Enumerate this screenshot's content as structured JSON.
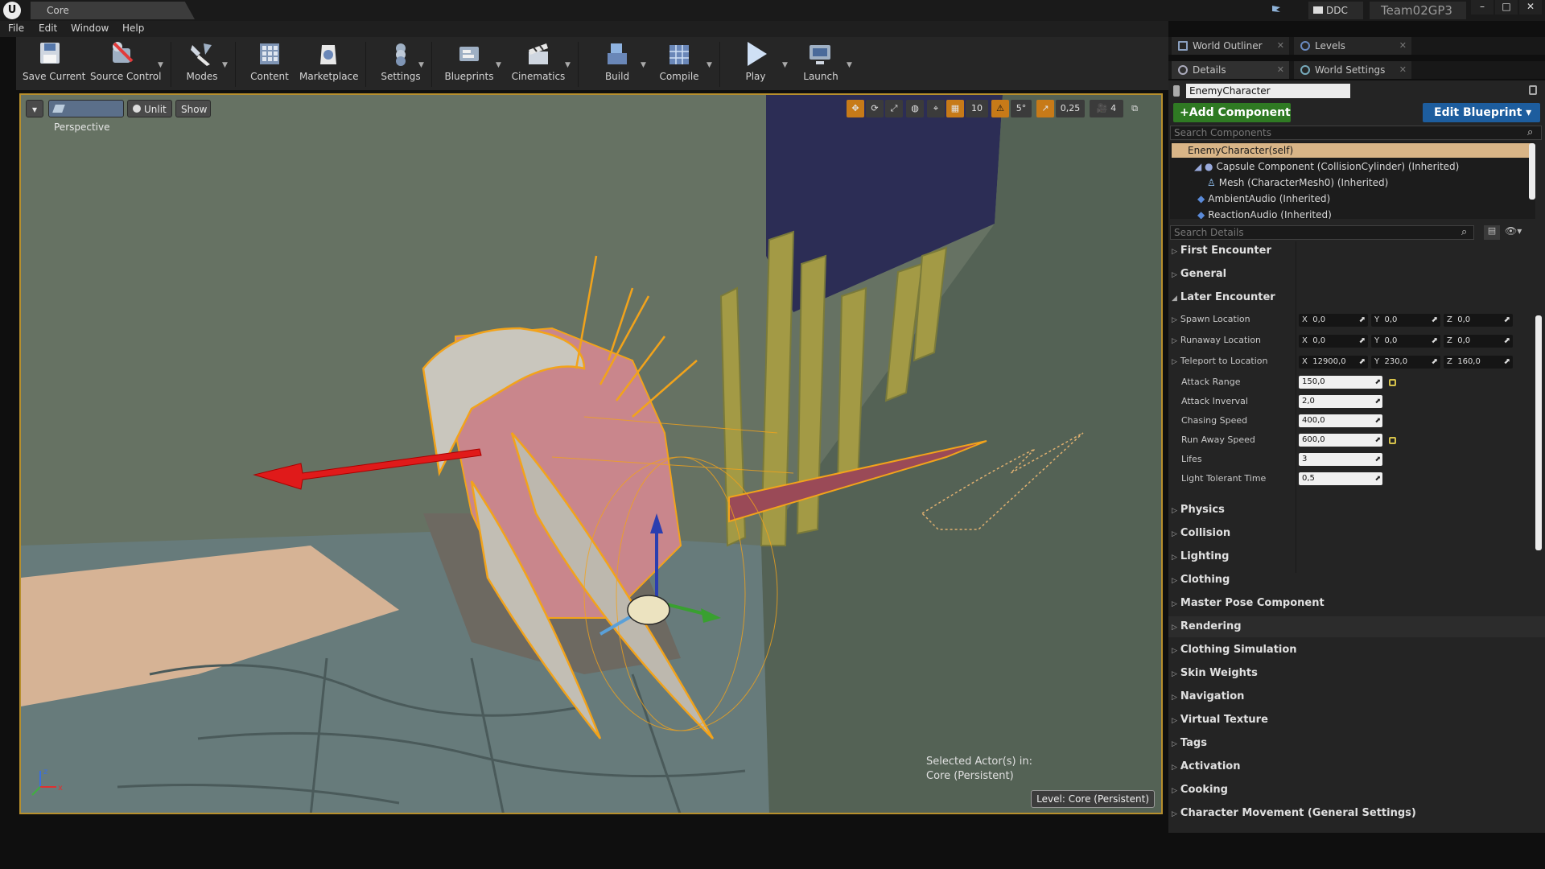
{
  "titlebar": {
    "logo": "U",
    "doc_tab": "Core",
    "ddc": "DDC",
    "project": "Team02GP3",
    "controls": {
      "minimize": "–",
      "maximize": "□",
      "close": "✕"
    }
  },
  "menu": [
    "File",
    "Edit",
    "Window",
    "Help"
  ],
  "toolbar": [
    {
      "label": "Save Current",
      "icon": "save-icon"
    },
    {
      "label": "Source Control",
      "icon": "source-control-icon"
    },
    {
      "label": "Modes",
      "icon": "modes-icon"
    },
    {
      "label": "Content",
      "icon": "content-icon"
    },
    {
      "label": "Marketplace",
      "icon": "marketplace-icon"
    },
    {
      "label": "Settings",
      "icon": "settings-icon"
    },
    {
      "label": "Blueprints",
      "icon": "blueprints-icon"
    },
    {
      "label": "Cinematics",
      "icon": "cinematics-icon"
    },
    {
      "label": "Build",
      "icon": "build-icon"
    },
    {
      "label": "Compile",
      "icon": "compile-icon"
    },
    {
      "label": "Play",
      "icon": "play-icon"
    },
    {
      "label": "Launch",
      "icon": "launch-icon"
    }
  ],
  "viewport": {
    "menu_glyph": "▾",
    "perspective": "Perspective",
    "unlit": "Unlit",
    "show": "Show",
    "grid_snap": "10",
    "rotation_snap": "5°",
    "scale_snap": "0,25",
    "camera_speed": "4",
    "selected_info_line1": "Selected Actor(s) in:",
    "selected_info_line2": "Core (Persistent)",
    "level_label": "Level:",
    "level_name": "Core (Persistent)",
    "colors": {
      "selection": "#f2a31b",
      "x_arrow": "#e01a1a",
      "border": "#b78f2d"
    }
  },
  "panels": {
    "world_outliner": "World Outliner",
    "levels": "Levels",
    "details": "Details",
    "world_settings": "World Settings",
    "tab_close": "✕"
  },
  "details": {
    "actor_name": "EnemyCharacter",
    "add_component": "+Add Component ▾",
    "edit_blueprint": "Edit Blueprint ▾",
    "search_components_placeholder": "Search Components",
    "search_details_placeholder": "Search Details",
    "components": [
      "EnemyCharacter(self)",
      "Capsule Component (CollisionCylinder) (Inherited)",
      "Mesh (CharacterMesh0) (Inherited)",
      "AmbientAudio (Inherited)",
      "ReactionAudio (Inherited)"
    ],
    "categories_top": [
      "First Encounter",
      "General",
      "Later Encounter"
    ],
    "vector_props": [
      {
        "name": "Spawn Location",
        "x": "0,0",
        "y": "0,0",
        "z": "0,0"
      },
      {
        "name": "Runaway Location",
        "x": "0,0",
        "y": "0,0",
        "z": "0,0"
      },
      {
        "name": "Teleport to Location",
        "x": "12900,0",
        "y": "230,0",
        "z": "160,0"
      }
    ],
    "axes": {
      "x": "X",
      "y": "Y",
      "z": "Z"
    },
    "scalar_props": [
      {
        "name": "Attack Range",
        "value": "150,0"
      },
      {
        "name": "Attack Inverval",
        "value": "2,0"
      },
      {
        "name": "Chasing Speed",
        "value": "400,0"
      },
      {
        "name": "Run Away Speed",
        "value": "600,0"
      },
      {
        "name": "Lifes",
        "value": "3"
      },
      {
        "name": "Light Tolerant Time",
        "value": "0,5"
      }
    ],
    "categories_bottom": [
      "Physics",
      "Collision",
      "Lighting",
      "Clothing",
      "Master Pose Component",
      "Rendering",
      "Clothing Simulation",
      "Skin Weights",
      "Navigation",
      "Virtual Texture",
      "Tags",
      "Activation",
      "Cooking",
      "Character Movement (General Settings)"
    ]
  }
}
